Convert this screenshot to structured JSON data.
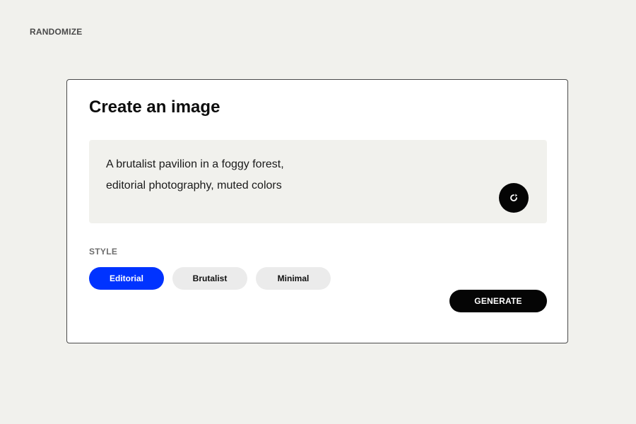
{
  "header": {
    "randomize_label": "RANDOMIZE"
  },
  "card": {
    "title": "Create an image",
    "prompt": {
      "lines": [
        "A brutalist pavilion in a foggy forest,",
        "editorial photography, muted colors"
      ],
      "refresh_icon": "refresh-icon"
    },
    "style_label": "STYLE",
    "styles": [
      {
        "label": "Editorial",
        "selected": true
      },
      {
        "label": "Brutalist",
        "selected": false
      },
      {
        "label": "Minimal",
        "selected": false
      }
    ],
    "generate_label": "GENERATE"
  },
  "colors": {
    "background": "#f1f1ed",
    "accent": "#0033ff",
    "primary_button": "#050505"
  }
}
